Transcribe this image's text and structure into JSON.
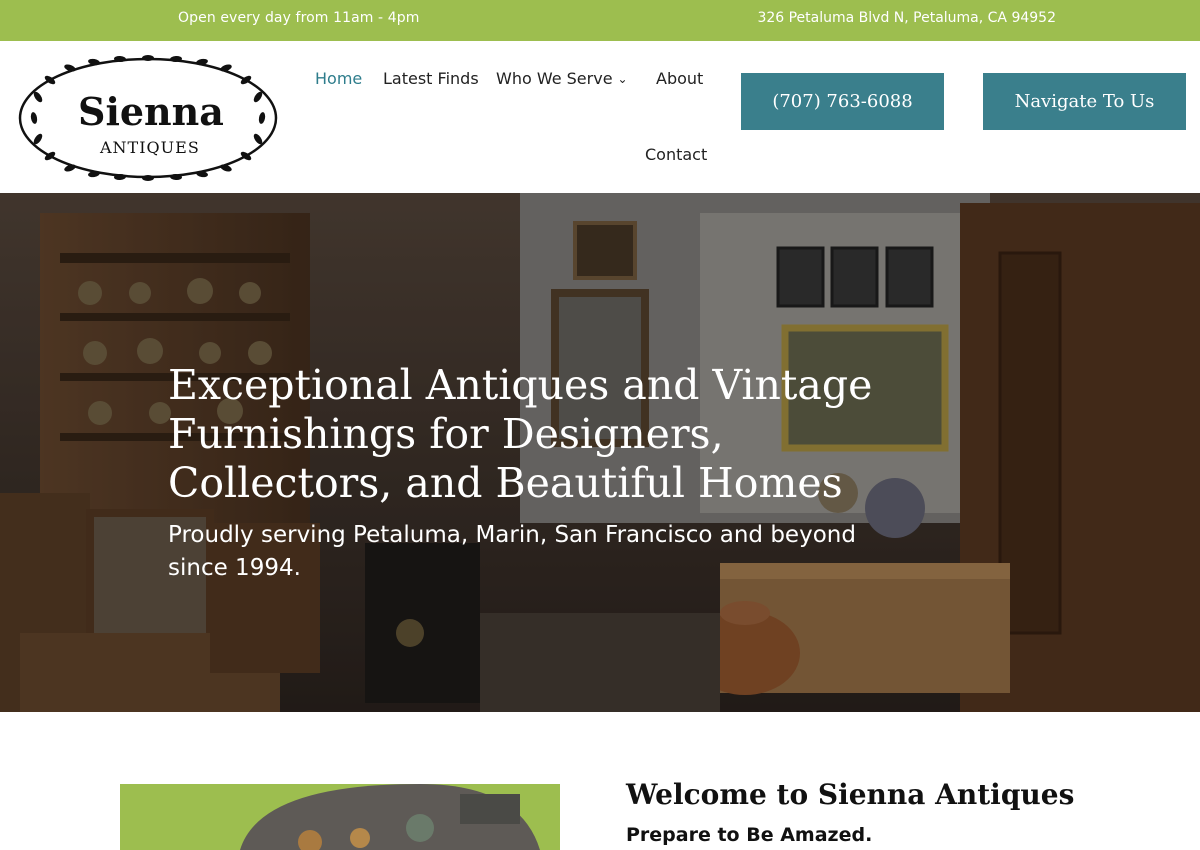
{
  "topbar": {
    "hours": "Open every day from 11am - 4pm",
    "address": "326 Petaluma Blvd N, Petaluma, CA 94952",
    "background": "#9dbe4f"
  },
  "logo": {
    "name": "Sienna",
    "tagline": "ANTIQUES"
  },
  "nav": {
    "items": [
      {
        "label": "Home",
        "active": true
      },
      {
        "label": "Latest Finds"
      },
      {
        "label": "Who We Serve",
        "has_dropdown": true
      },
      {
        "label": "About"
      },
      {
        "label": "Contact"
      }
    ]
  },
  "buttons": {
    "phone": "(707) 763-6088",
    "navigate": "Navigate To Us",
    "color": "#3a7f8c"
  },
  "hero": {
    "title": "Exceptional Antiques and Vintage Furnishings for Designers, Collectors, and Beautiful Homes",
    "subtitle": "Proudly serving Petaluma, Marin, San Francisco and beyond since 1994."
  },
  "welcome": {
    "title": "Welcome to Sienna Antiques",
    "subtitle": "Prepare to Be Amazed."
  },
  "colors": {
    "accent_green": "#9dbe4f",
    "accent_teal": "#3a7f8c",
    "active_link": "#2e7d8c"
  }
}
